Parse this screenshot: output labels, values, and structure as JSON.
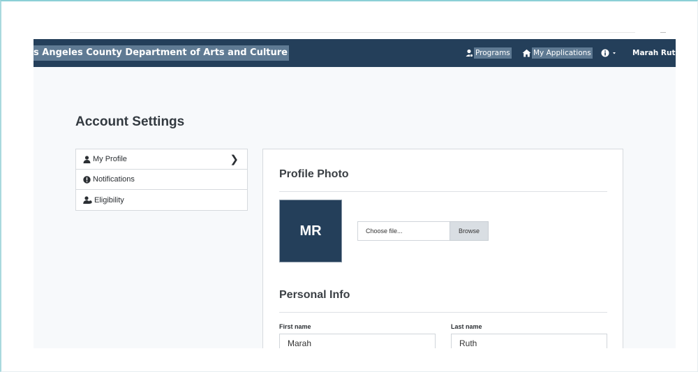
{
  "navbar": {
    "brand": "s Angeles County Department of Arts and Culture",
    "programs_label": "Programs",
    "applications_label": "My Applications",
    "user_name": "Marah Ruth"
  },
  "page": {
    "title": "Account Settings"
  },
  "side_menu": {
    "items": [
      {
        "label": "My Profile",
        "icon": "user-icon",
        "active": true
      },
      {
        "label": "Notifications",
        "icon": "exclamation-circle-icon"
      },
      {
        "label": "Eligibility",
        "icon": "user-check-icon"
      }
    ]
  },
  "profile_photo": {
    "heading": "Profile Photo",
    "initials": "MR",
    "file_placeholder": "Choose file...",
    "browse_label": "Browse"
  },
  "personal_info": {
    "heading": "Personal Info",
    "first_name_label": "First name",
    "first_name_value": "Marah",
    "last_name_label": "Last name",
    "last_name_value": "Ruth"
  },
  "colors": {
    "navbar_bg": "#243f5a",
    "highlight": "#5f7a93",
    "page_bg": "#f7f9fb",
    "avatar_bg": "#243f5a"
  }
}
